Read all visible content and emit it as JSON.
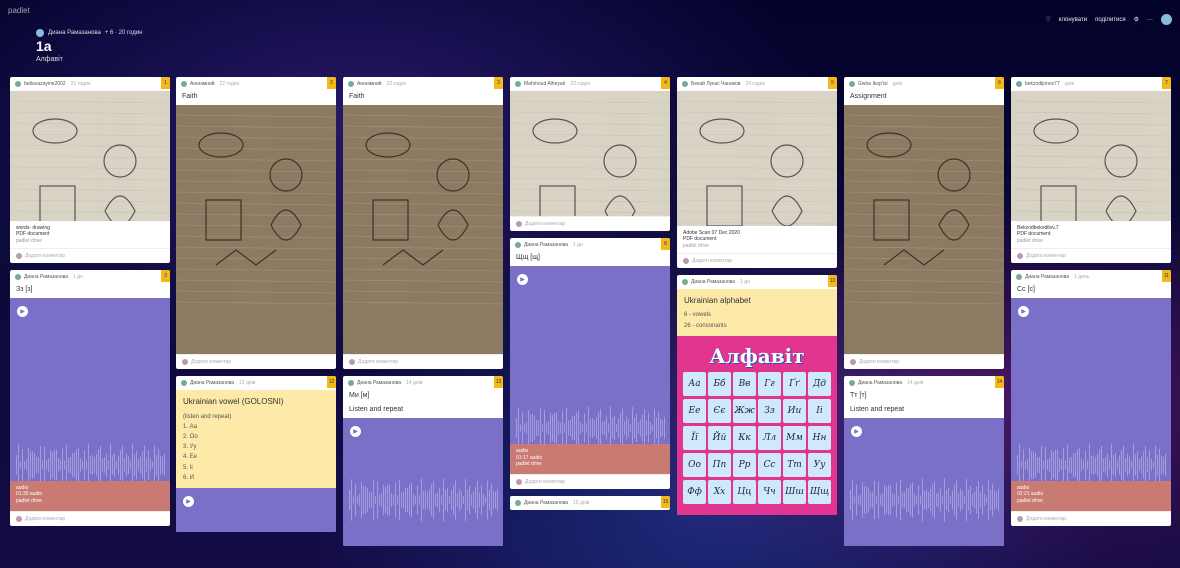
{
  "header": {
    "brand": "padlet",
    "author": "Диана Рамазанова",
    "author_meta": "+ 6 · 20 годин",
    "title": "1а",
    "subtitle": "Алфавіт",
    "actions": {
      "like": "♡",
      "clone": "клонувати",
      "share": "поділитися",
      "settings": "⚙",
      "more": "···"
    }
  },
  "columns": [
    {
      "cards": [
        {
          "type": "image",
          "author": "fadiavazayine2002",
          "time": "21 годин",
          "num": "1",
          "image_class": "",
          "image_h": 130,
          "caption": "words- drawing",
          "caption2": "PDF document",
          "caption3": "padlet drive",
          "comment": "Додати коментар"
        },
        {
          "type": "audio",
          "author": "Диана Рамазанова",
          "time": "1 дн",
          "num": "3",
          "title": "Зз [з]",
          "audio_h": 213,
          "audio_time": "01:30 audio",
          "audio_label": "audio",
          "audio_sub": "padlet drive",
          "comment": "Додати коментар"
        }
      ]
    },
    {
      "cards": [
        {
          "type": "image",
          "author": "Анонімний",
          "time": "22 годин",
          "num": "2",
          "title": "Faith",
          "image_class": "dark",
          "image_h": 249,
          "comment": "Додати коментар"
        },
        {
          "type": "note",
          "author": "Диана Рамазанова",
          "time": "13 днів",
          "num": "12",
          "note_title": "Ukrainian vowel  (GOLOSNI)",
          "lines": [
            "(listen and repeat)",
            "1. Аа",
            "2. Оо",
            "3. Уу",
            "4. Ее",
            "5. Іі",
            "6. И"
          ],
          "audio_after": true
        }
      ]
    },
    {
      "cards": [
        {
          "type": "image",
          "author": "Анонімний",
          "time": "22 годин",
          "num": "3",
          "title": "Faith",
          "image_class": "dark",
          "image_h": 249,
          "comment": "Додати коментар"
        },
        {
          "type": "audio",
          "author": "Диана Рамазанова",
          "time": "14 днів",
          "num": "13",
          "title": "Ми [м]",
          "sub": "Listen and repeat",
          "audio_h": 128
        }
      ]
    },
    {
      "cards": [
        {
          "type": "image",
          "author": "Mahmoud Alheyari",
          "time": "22 годин",
          "num": "4",
          "image_class": "",
          "image_h": 125,
          "comment": "Додати коментар"
        },
        {
          "type": "audio",
          "author": "Диана Рамазанова",
          "time": "1 дн",
          "num": "8",
          "title": "Щщ [щ]",
          "audio_h": 208,
          "audio_time": "01:17 audio",
          "audio_label": "audio",
          "audio_sub": "padlet drive",
          "comment": "Додати коментар"
        },
        {
          "type": "stub",
          "author": "Диана Рамазанова",
          "time": "10 днів",
          "num": "15"
        }
      ]
    },
    {
      "cards": [
        {
          "type": "image",
          "author": "Бекай Лукас Чанаков",
          "time": "24 годин",
          "num": "5",
          "image_class": "",
          "image_h": 135,
          "caption": "Adobe Scan 07 Dec 2020",
          "caption2": "PDF document",
          "caption3": "padlet drive",
          "comment": "Додати коментар"
        },
        {
          "type": "alpha",
          "author": "Диана Рамазанова",
          "time": "1 дн",
          "num": "10",
          "note_title": "Ukrainian  alphabet",
          "lines": [
            "6 - vowels",
            "26 - consonants"
          ],
          "alpha_title": "Алфавіт",
          "cells": [
            "Аа",
            "Бб",
            "Вв",
            "Гг",
            "Ґґ",
            "Дд",
            "Ее",
            "Єє",
            "Жж",
            "Зз",
            "Ии",
            "Іі",
            "Її",
            "Йй",
            "Кк",
            "Лл",
            "Мм",
            "Нн",
            "Оо",
            "Пп",
            "Рр",
            "Сс",
            "Тт",
            "Уу",
            "Фф",
            "Хх",
            "Цц",
            "Чч",
            "Шш",
            "Щщ"
          ]
        }
      ]
    },
    {
      "cards": [
        {
          "type": "image",
          "author": "Gwira Ikop'isi",
          "time": "днів",
          "num": "6",
          "title": "Assignment",
          "image_class": "dark",
          "image_h": 249,
          "comment": "Додати коментар"
        },
        {
          "type": "audio",
          "author": "Диана Рамазанова",
          "time": "14 днів",
          "num": "14",
          "title": "Тт [т]",
          "sub": "Listen and repeat",
          "audio_h": 128
        }
      ]
    },
    {
      "cards": [
        {
          "type": "image",
          "author": "bekzodijonov77",
          "time": "днів",
          "num": "7",
          "image_class": "",
          "image_h": 130,
          "caption": "Bekzodbekodilov,7",
          "caption2": "PDF document",
          "caption3": "padlet drive",
          "comment": "Додати коментар"
        },
        {
          "type": "audio",
          "author": "Диана Рамазанова",
          "time": "1 день",
          "num": "11",
          "title": "Сс [с]",
          "audio_h": 213,
          "audio_time": "02:21 audio",
          "audio_label": "audio",
          "audio_sub": "padlet drive",
          "comment": "Додати коментар"
        }
      ]
    }
  ]
}
